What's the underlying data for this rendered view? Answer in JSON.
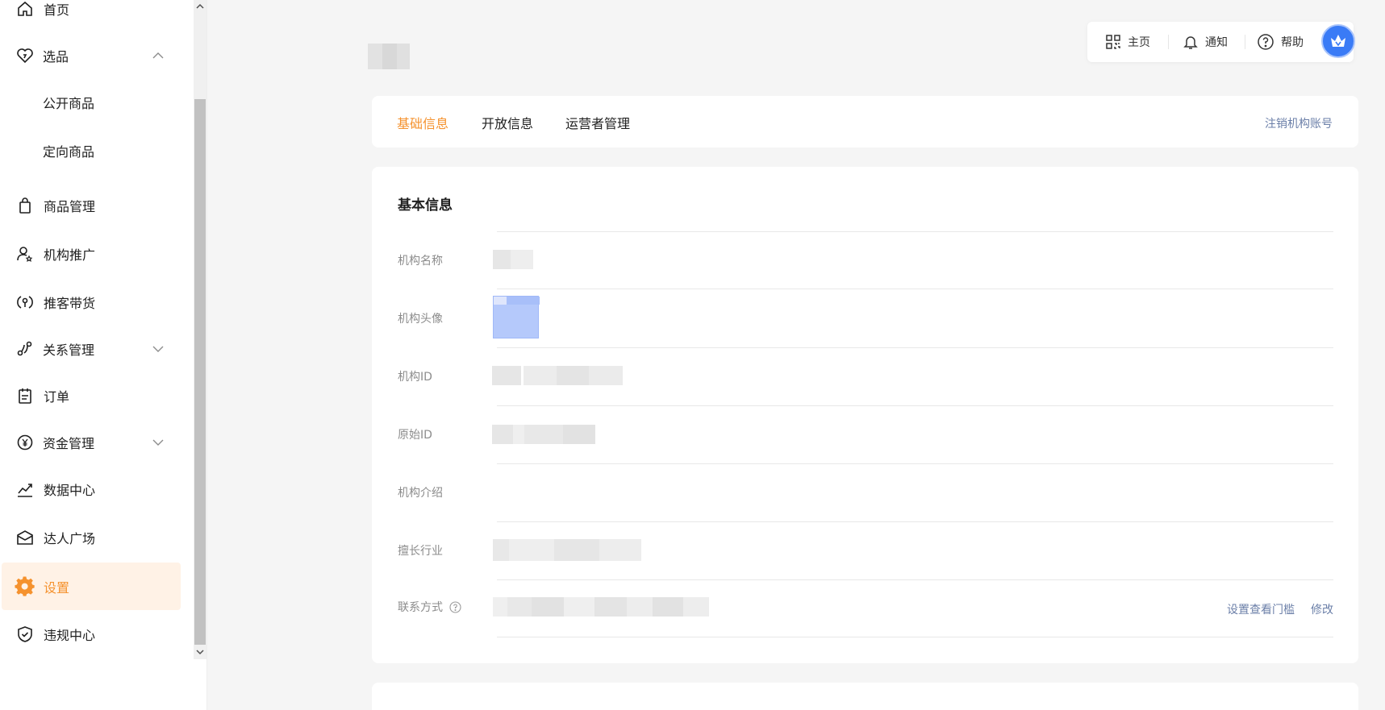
{
  "sidebar": {
    "items": {
      "home": {
        "label": "首页",
        "icon": "home-icon"
      },
      "selection": {
        "label": "选品",
        "icon": "heart-tag-icon"
      },
      "public_goods": {
        "label": "公开商品"
      },
      "targeted_goods": {
        "label": "定向商品"
      },
      "goods_mgmt": {
        "label": "商品管理",
        "icon": "bag-icon"
      },
      "org_promo": {
        "label": "机构推广",
        "icon": "user-star-icon"
      },
      "referral_sales": {
        "label": "推客带货",
        "icon": "coin-icon"
      },
      "relations": {
        "label": "关系管理",
        "icon": "relation-icon"
      },
      "orders": {
        "label": "订单",
        "icon": "order-icon"
      },
      "funds": {
        "label": "资金管理",
        "icon": "yen-icon"
      },
      "data_center": {
        "label": "数据中心",
        "icon": "trend-icon"
      },
      "talent_square": {
        "label": "达人广场",
        "icon": "mail-icon"
      },
      "settings": {
        "label": "设置",
        "icon": "gear-icon"
      },
      "violations": {
        "label": "违规中心",
        "icon": "shield-check-icon"
      }
    }
  },
  "toolbar": {
    "home_label": "主页",
    "notify_label": "通知",
    "help_label": "帮助"
  },
  "tabs": {
    "basic": "基础信息",
    "open": "开放信息",
    "operators": "运营者管理",
    "cancel_account": "注销机构账号"
  },
  "basic_info": {
    "title": "基本信息",
    "org_name_label": "机构名称",
    "org_avatar_label": "机构头像",
    "org_id_label": "机构ID",
    "original_id_label": "原始ID",
    "org_intro_label": "机构介绍",
    "industry_label": "擅长行业",
    "contact_label": "联系方式",
    "set_threshold": "设置查看门槛",
    "edit": "修改"
  },
  "colors": {
    "accent": "#f5922e",
    "link": "#6b7fa8",
    "avatar_blue": "#3a7bf6"
  }
}
